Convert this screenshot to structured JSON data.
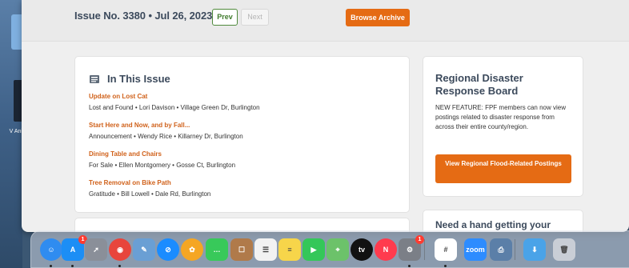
{
  "desktop": {
    "label": "V Ani"
  },
  "issue_bar": {
    "title": "Issue No. 3380 • Jul 26, 2023",
    "prev_label": "Prev",
    "next_label": "Next",
    "archive_label": "Browse Archive"
  },
  "in_this_issue": {
    "title": "In This Issue",
    "items": [
      {
        "title": "Update on Lost Cat",
        "meta": "Lost and Found • Lori Davison • Village Green Dr, Burlington"
      },
      {
        "title": "Start Here and Now, and by Fall...",
        "meta": "Announcement • Wendy Rice • Killarney Dr, Burlington"
      },
      {
        "title": "Dining Table and Chairs",
        "meta": "For Sale • Ellen Montgomery • Gosse Ct, Burlington"
      },
      {
        "title": "Tree Removal on Bike Path",
        "meta": "Gratitude • Bill Lowell • Dale Rd, Burlington"
      }
    ]
  },
  "disaster": {
    "title": "Regional Disaster Response Board",
    "body": "NEW FEATURE: FPF members can now view postings related to disaster response from across their entire county/region.",
    "button_label": "View Regional Flood-Related Postings"
  },
  "hand": {
    "title": "Need a hand getting your"
  },
  "dock": {
    "icons": [
      {
        "name": "finder-icon",
        "color": "#2f8cf0",
        "glyph": "☺"
      },
      {
        "name": "app-store-icon",
        "color": "#1c8ef5",
        "glyph": "A",
        "badge": "1"
      },
      {
        "name": "launchpad-icon",
        "color": "#8a8f99",
        "glyph": "➚"
      },
      {
        "name": "chrome-icon",
        "color": "#e8453c",
        "glyph": "◉"
      },
      {
        "name": "preview-icon",
        "color": "#6a9fd4",
        "glyph": "✎"
      },
      {
        "name": "safari-icon",
        "color": "#1a8cff",
        "glyph": "⊘"
      },
      {
        "name": "photos-icon",
        "color": "#f5a623",
        "glyph": "✿"
      },
      {
        "name": "messages-icon",
        "color": "#38c95a",
        "glyph": "…"
      },
      {
        "name": "contacts-icon",
        "color": "#b07a4a",
        "glyph": "☐"
      },
      {
        "name": "reminders-icon",
        "color": "#f2f2f2",
        "glyph": "☰"
      },
      {
        "name": "notes-icon",
        "color": "#f7d54a",
        "glyph": "≡"
      },
      {
        "name": "facetime-icon",
        "color": "#34c759",
        "glyph": "▶"
      },
      {
        "name": "maps-icon",
        "color": "#6cc26a",
        "glyph": "⌖"
      },
      {
        "name": "apple-tv-icon",
        "color": "#111111",
        "glyph": "tv"
      },
      {
        "name": "news-icon",
        "color": "#ff3b4e",
        "glyph": "N"
      },
      {
        "name": "system-preferences-icon",
        "color": "#7b7f87",
        "glyph": "⚙",
        "badge": "1"
      },
      {
        "name": "slack-icon",
        "color": "#ffffff",
        "glyph": "#"
      },
      {
        "name": "zoom-icon",
        "color": "#2d8cff",
        "glyph": "zoom"
      },
      {
        "name": "image-capture-icon",
        "color": "#5b7fa8",
        "glyph": "⎙"
      },
      {
        "name": "downloads-icon",
        "color": "#4aa3e8",
        "glyph": "⬇"
      },
      {
        "name": "trash-icon",
        "color": "#c9ced6",
        "glyph": "🗑"
      }
    ]
  }
}
